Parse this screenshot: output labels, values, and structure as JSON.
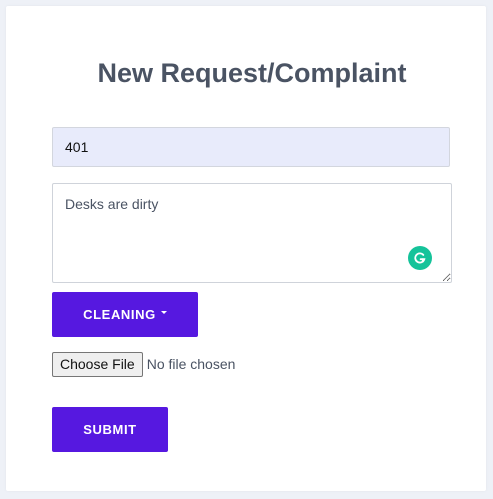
{
  "form": {
    "title": "New Request/Complaint",
    "room_value": "401",
    "description_value": "Desks are dirty",
    "category_label": "CLEANING",
    "file_button_label": "Choose File",
    "file_status": "No file chosen",
    "submit_label": "SUBMIT"
  },
  "icons": {
    "grammarly": "grammarly-icon",
    "caret": "caret-down-icon"
  },
  "colors": {
    "accent": "#5618e0",
    "title": "#4a5363",
    "input_autofill_bg": "#e8ebfb",
    "grammarly": "#15c39a"
  }
}
